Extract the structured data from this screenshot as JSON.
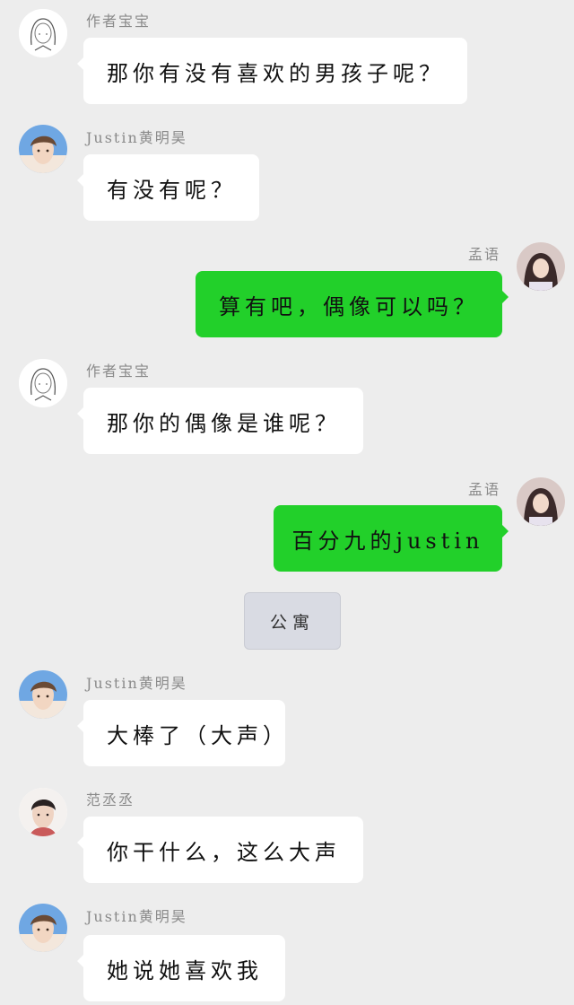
{
  "chat": {
    "messages": [
      {
        "sender": "作者宝宝",
        "text": "那你有没有喜欢的男孩子呢？",
        "side": "left",
        "avatar": "sketch-girl-avatar"
      },
      {
        "sender": "Justin黄明昊",
        "text": "有没有呢？",
        "side": "left",
        "avatar": "justin-avatar"
      },
      {
        "sender": "孟语",
        "text": "算有吧，偶像可以吗？",
        "side": "right",
        "avatar": "mengyu-avatar"
      },
      {
        "sender": "作者宝宝",
        "text": "那你的偶像是谁呢？",
        "side": "left",
        "avatar": "sketch-girl-avatar"
      },
      {
        "sender": "孟语",
        "text": "百分九的justin",
        "side": "right",
        "avatar": "mengyu-avatar"
      },
      {
        "sender": "Justin黄明昊",
        "text": "大棒了（大声）",
        "side": "left",
        "avatar": "justin-avatar"
      },
      {
        "sender": "范丞丞",
        "text": "你干什么，这么大声",
        "side": "left",
        "avatar": "fan-avatar"
      },
      {
        "sender": "Justin黄明昊",
        "text": "她说她喜欢我",
        "side": "left",
        "avatar": "justin-avatar"
      }
    ],
    "system_note": "公寓"
  },
  "colors": {
    "background": "#ededed",
    "incoming_bubble": "#ffffff",
    "outgoing_bubble": "#22d02a",
    "name_text": "#8a8a8a",
    "system_pill": "#d9dbe3"
  }
}
